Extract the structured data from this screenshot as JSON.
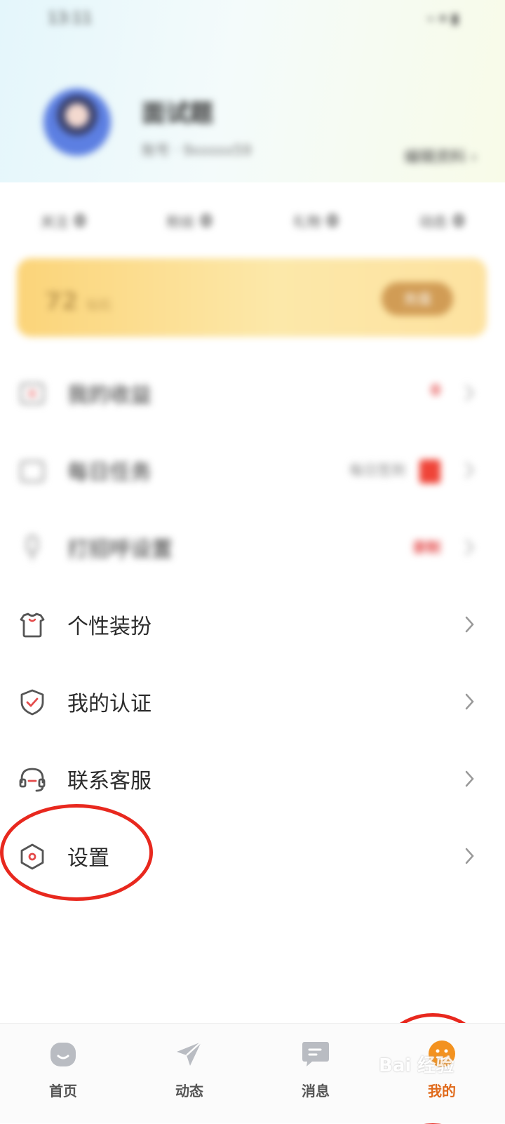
{
  "status_bar": {
    "time": "13:11",
    "icons": "⌁ ▾ ▮"
  },
  "profile": {
    "name": "面试题",
    "id_text": "账号 · 9xxxxx59",
    "edit_label": "编辑资料"
  },
  "stats": [
    {
      "label": "关注",
      "value": "0"
    },
    {
      "label": "粉丝",
      "value": "0"
    },
    {
      "label": "礼物",
      "value": "0"
    },
    {
      "label": "动态",
      "value": "0"
    }
  ],
  "vip": {
    "value": "72",
    "unit": "钻石",
    "button_label": "充值"
  },
  "menu": [
    {
      "id": "earnings",
      "label": "我的收益",
      "right_text": "0",
      "icon": "wallet-icon"
    },
    {
      "id": "daily-tasks",
      "label": "每日任务",
      "right_text": "每日签到",
      "icon": "calendar-icon"
    },
    {
      "id": "call-settings",
      "label": "打招呼设置",
      "right_text": "录制",
      "icon": "microphone-icon"
    },
    {
      "id": "personal-dress",
      "label": "个性装扮",
      "right_text": "",
      "icon": "shirt-icon"
    },
    {
      "id": "my-certification",
      "label": "我的认证",
      "right_text": "",
      "icon": "shield-check-icon"
    },
    {
      "id": "contact-service",
      "label": "联系客服",
      "right_text": "",
      "icon": "headset-icon"
    },
    {
      "id": "settings",
      "label": "设置",
      "right_text": "",
      "icon": "hexagon-gear-icon"
    }
  ],
  "tabbar": [
    {
      "label": "首页",
      "icon": "home-icon",
      "active": false
    },
    {
      "label": "动态",
      "icon": "send-icon",
      "active": false
    },
    {
      "label": "消息",
      "icon": "message-icon",
      "active": false
    },
    {
      "label": "我的",
      "icon": "profile-icon",
      "active": true
    }
  ],
  "watermark": "Bai 经验",
  "colors": {
    "accent": "#e06a1b",
    "highlight_ring": "#e8281e",
    "vip_gold": "#fbd479"
  }
}
